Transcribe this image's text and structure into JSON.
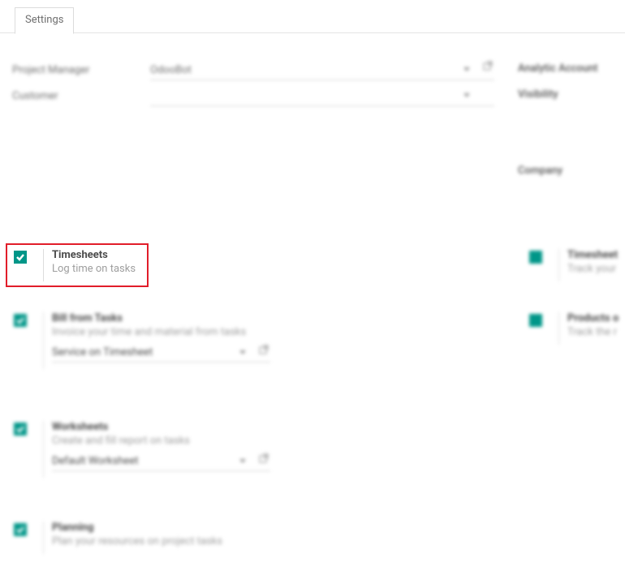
{
  "tabs": {
    "settings": "Settings"
  },
  "fields": {
    "project_manager_label": "Project Manager",
    "project_manager_value": "OdooBot",
    "customer_label": "Customer",
    "customer_value": "",
    "analytic_account_label": "Analytic Account",
    "visibility_label": "Visibility",
    "company_label": "Company"
  },
  "options": {
    "timesheets": {
      "title": "Timesheets",
      "desc": "Log time on tasks"
    },
    "bill_from_tasks": {
      "title": "Bill from Tasks",
      "desc": "Invoice your time and material from tasks",
      "select_value": "Service on Timesheet"
    },
    "worksheets": {
      "title": "Worksheets",
      "desc": "Create and fill report on tasks",
      "select_value": "Default Worksheet"
    },
    "planning": {
      "title": "Planning",
      "desc": "Plan your resources on project tasks"
    }
  },
  "right_options": {
    "timesheet_timer": {
      "title": "Timesheet",
      "desc": "Track your"
    },
    "products": {
      "title": "Products o",
      "desc": "Track the r"
    }
  }
}
